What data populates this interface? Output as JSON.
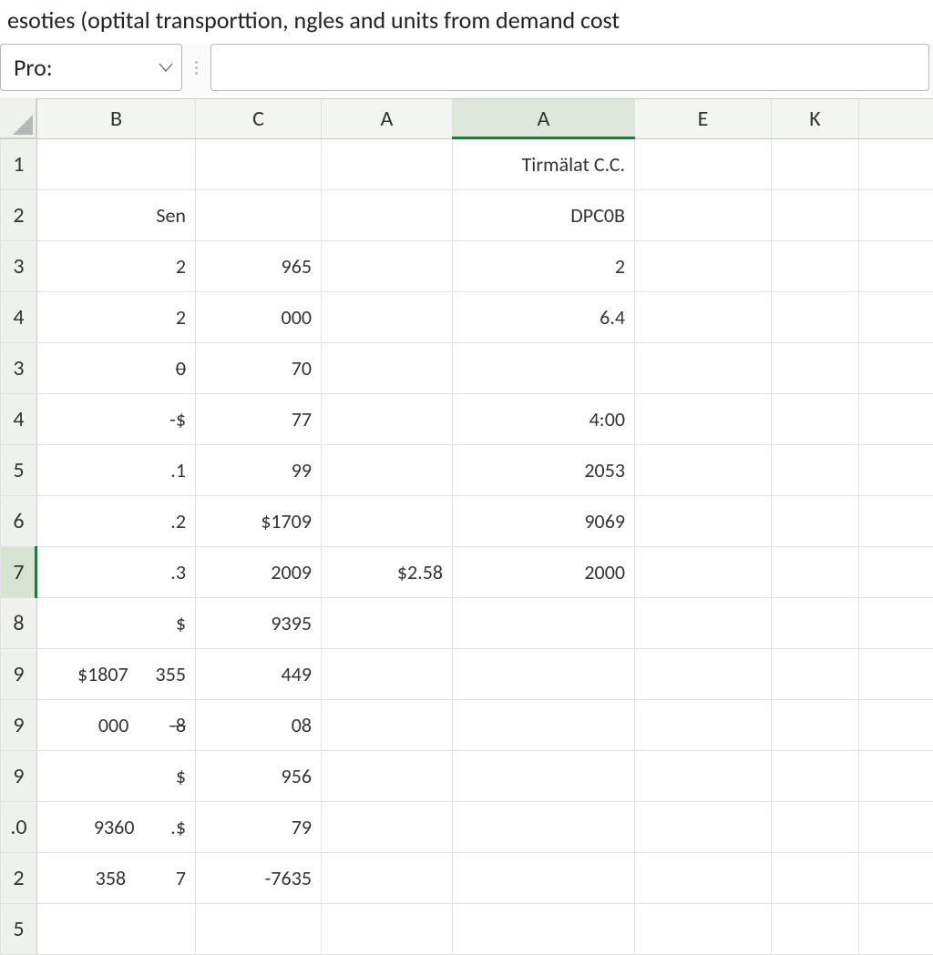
{
  "titlebar": {
    "text": "esoties (optital transporttion, ngles and units from demand cost"
  },
  "namebox": {
    "value": "Pro:"
  },
  "formula_bar": {
    "value": ""
  },
  "column_headers": [
    "B",
    "C",
    "A",
    "A",
    "E",
    "K",
    ""
  ],
  "active_column_index": 3,
  "row_headers": [
    "1",
    "2",
    "3",
    "4",
    "3",
    "4",
    "5",
    "6",
    "7",
    "8",
    "9",
    "9",
    "9",
    ".0",
    "2",
    "5"
  ],
  "selected_row_index": 8,
  "cells": {
    "r1": {
      "b": "",
      "c": "",
      "a": "",
      "d": "Tirmälat C.C.",
      "e": "",
      "k": ""
    },
    "r2": {
      "b": "Sen",
      "c": "",
      "a": "",
      "d": "DPC0B",
      "e": "",
      "k": ""
    },
    "r3": {
      "b": "2",
      "c": "965",
      "a": "",
      "d": "2",
      "e": "",
      "k": ""
    },
    "r4": {
      "b": "2",
      "c": "000",
      "a": "",
      "d": "6.4",
      "e": "",
      "k": ""
    },
    "r5": {
      "b": "0",
      "c": "70",
      "a": "",
      "d": "",
      "e": "",
      "k": ""
    },
    "r6": {
      "b": "-$",
      "c": "77",
      "a": "",
      "d": "4:00",
      "e": "",
      "k": ""
    },
    "r7": {
      "b": ".1",
      "c": "99",
      "a": "",
      "d": "2053",
      "e": "",
      "k": ""
    },
    "r8": {
      "b": ".2",
      "c": "$1709",
      "a": "",
      "d": "9069",
      "e": "",
      "k": ""
    },
    "r9": {
      "b": ".3",
      "c": "2009",
      "a": "$2.58",
      "d": "2000",
      "e": "",
      "k": ""
    },
    "r10": {
      "b": "$",
      "c": "9395",
      "a": "",
      "d": "",
      "e": "",
      "k": ""
    },
    "r11_a": "$1807",
    "r11": {
      "b": "355",
      "c": "449",
      "a": "",
      "d": "",
      "e": "",
      "k": ""
    },
    "r12_a": "000",
    "r12": {
      "b": "-8",
      "c": "08",
      "a": "",
      "d": "",
      "e": "",
      "k": ""
    },
    "r13": {
      "b": "$",
      "c": "956",
      "a": "",
      "d": "",
      "e": "",
      "k": ""
    },
    "r14_a": "9360",
    "r14": {
      "b": ".$",
      "c": "79",
      "a": "",
      "d": "",
      "e": "",
      "k": ""
    },
    "r15_a": "358",
    "r15": {
      "b": "7",
      "c": "-7635",
      "a": "",
      "d": "",
      "e": "",
      "k": ""
    },
    "r16": {
      "b": "",
      "c": "",
      "a": "",
      "d": "",
      "e": "",
      "k": ""
    }
  }
}
